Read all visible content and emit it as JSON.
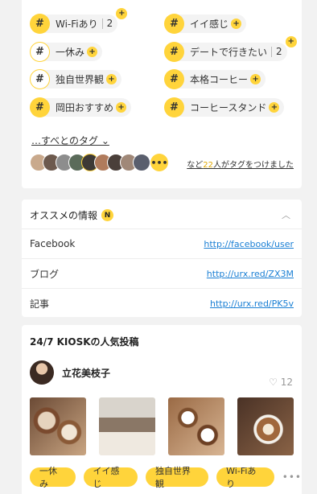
{
  "tags": {
    "items": [
      {
        "label": "Wi-Fiあり",
        "count": "2",
        "style": "filled",
        "plus": "corner"
      },
      {
        "label": "イイ感じ",
        "count": "",
        "style": "filled",
        "plus": "inline"
      },
      {
        "label": "一休み",
        "count": "",
        "style": "outline",
        "plus": "inline"
      },
      {
        "label": "デートで行きたい",
        "count": "2",
        "style": "filled",
        "plus": "corner"
      },
      {
        "label": "独自世界観",
        "count": "",
        "style": "outline",
        "plus": "inline"
      },
      {
        "label": "本格コーヒー",
        "count": "",
        "style": "filled",
        "plus": "inline"
      },
      {
        "label": "岡田おすすめ",
        "count": "",
        "style": "filled",
        "plus": "inline"
      },
      {
        "label": "コーヒースタンド",
        "count": "",
        "style": "filled",
        "plus": "inline"
      }
    ],
    "hash_symbol": "#",
    "plus_symbol": "+",
    "all_tags_link": "…すべとのタグ ⌄",
    "more_avatars": "•••",
    "summary_prefix": "など",
    "summary_count": "22",
    "summary_suffix": "人がタグをつけました"
  },
  "info": {
    "title": "オススメの情報",
    "badge": "N",
    "caret": "︿",
    "rows": [
      {
        "key": "Facebook",
        "value": "http://facebook/user"
      },
      {
        "key": "ブログ",
        "value": "http://urx.red/ZX3M"
      },
      {
        "key": "記事",
        "value": "http://urx.red/PK5v"
      }
    ]
  },
  "popular": {
    "title": "24/7 KIOSKの人気投稿",
    "author": "立花美枝子",
    "likes": "♡ 12",
    "bottom_tags": [
      "一休み",
      "イイ感じ",
      "独自世界観",
      "Wi-Fiあり"
    ],
    "more": "•••"
  },
  "colors": {
    "accent": "#ffd43b",
    "link": "#1a7fd4"
  }
}
